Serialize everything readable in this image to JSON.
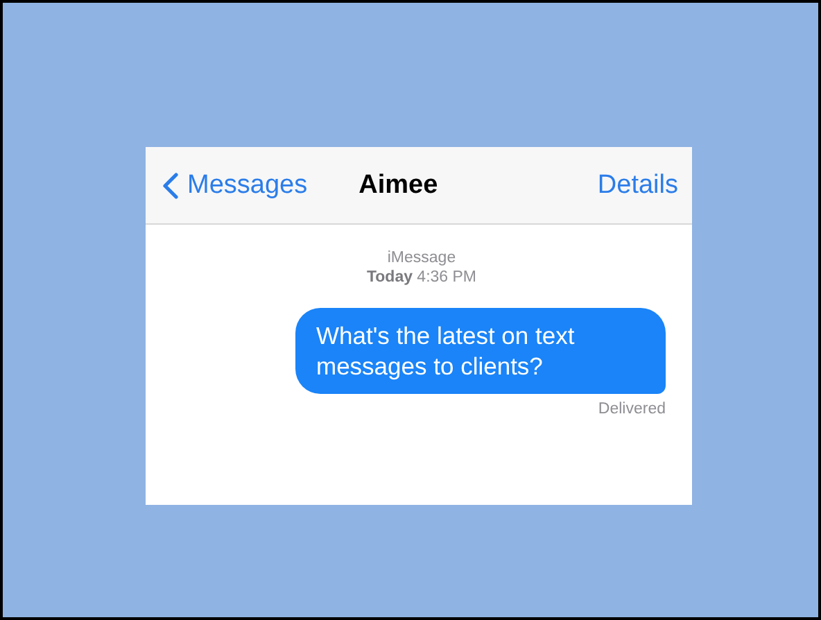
{
  "nav": {
    "back": "Messages",
    "title": "Aimee",
    "action": "Details"
  },
  "conversation": {
    "service": "iMessage",
    "timestamp": "**Today** 4:36 PM",
    "messages": [
      {
        "text": "What's the latest on text messages to clients?",
        "outgoing": true,
        "status": "Delivered"
      }
    ]
  }
}
